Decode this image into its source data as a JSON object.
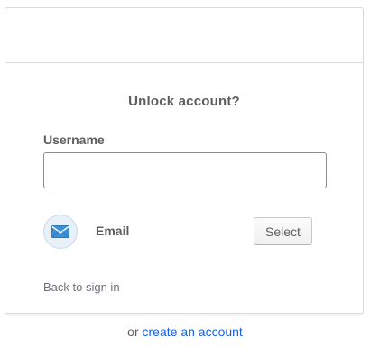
{
  "form": {
    "title": "Unlock account?",
    "username_label": "Username",
    "username_value": "",
    "username_placeholder": ""
  },
  "factor": {
    "icon": "envelope-icon",
    "label": "Email",
    "select_label": "Select"
  },
  "links": {
    "back_to_sign_in": "Back to sign in"
  },
  "footer": {
    "prefix": "or",
    "create_account": "create an account"
  },
  "colors": {
    "link": "#1662dd",
    "envelope": "#3c8fd6",
    "text": "#5e5e5e"
  }
}
